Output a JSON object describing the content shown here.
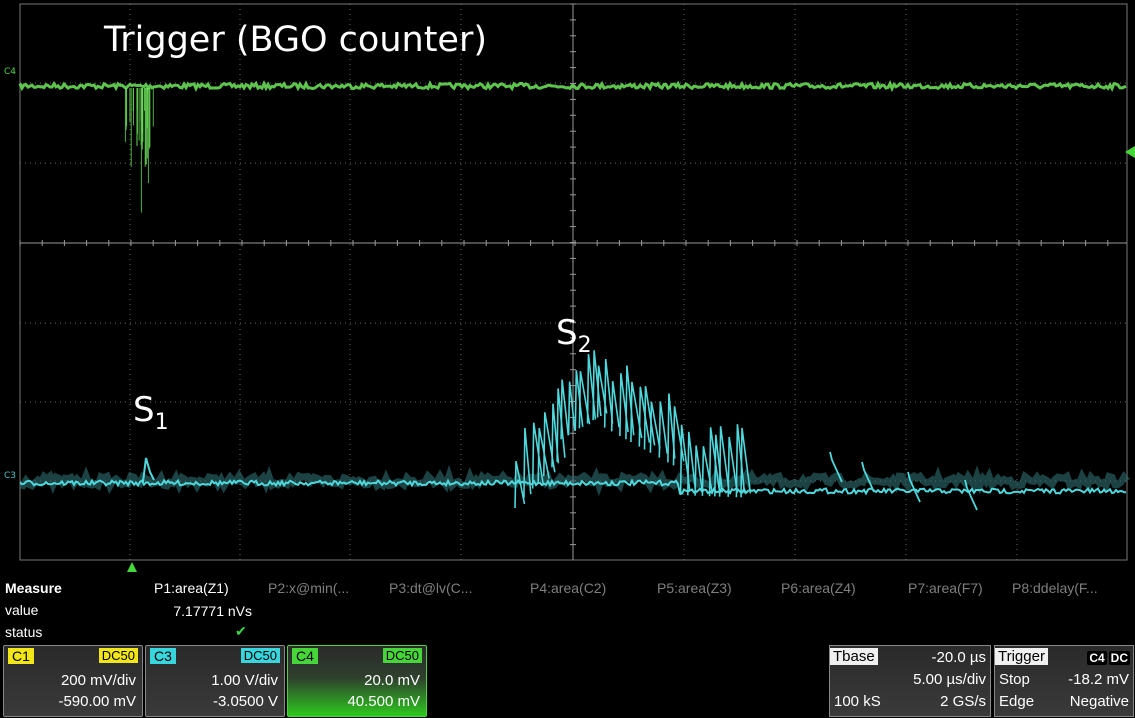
{
  "annotations": {
    "title": "Trigger (BGO counter)",
    "s1_letter": "S",
    "s1_sub": "1",
    "s2_letter": "S",
    "s2_sub": "2"
  },
  "channel_tags": {
    "c4": "C4",
    "c3": "C3"
  },
  "measure": {
    "header": "Measure",
    "value_label": "value",
    "status_label": "status",
    "params": [
      "P1:area(Z1)",
      "P2:x@min(...",
      "P3:dt@lv(C...",
      "P4:area(C2)",
      "P5:area(Z3)",
      "P6:area(Z4)",
      "P7:area(F7)",
      "P8:ddelay(F..."
    ],
    "p1_value": "7.17771 nVs",
    "p1_status": "✔"
  },
  "channels": [
    {
      "id": "C1",
      "coupling": "DC50",
      "vdiv": "200 mV/div",
      "offset": "-590.00 mV",
      "color": "#f2e51a"
    },
    {
      "id": "C3",
      "coupling": "DC50",
      "vdiv": "1.00 V/div",
      "offset": "-3.0500 V",
      "color": "#38d6dc"
    },
    {
      "id": "C4",
      "coupling": "DC50",
      "vdiv": "20.0 mV",
      "offset": "40.500 mV",
      "color": "#46d63a"
    }
  ],
  "timebase": {
    "label": "Tbase",
    "delay": "-20.0 µs",
    "tdiv": "5.00 µs/div",
    "samples": "100 kS",
    "rate": "2 GS/s"
  },
  "trigger": {
    "label": "Trigger",
    "source": "C4",
    "coupling": "DC",
    "mode": "Stop",
    "level": "-18.2 mV",
    "type": "Edge",
    "slope": "Negative"
  },
  "colors": {
    "trigger_trace": "#6fe65c",
    "signal_trace": "#4fd8dc",
    "grid": "#6a6a6a"
  }
}
